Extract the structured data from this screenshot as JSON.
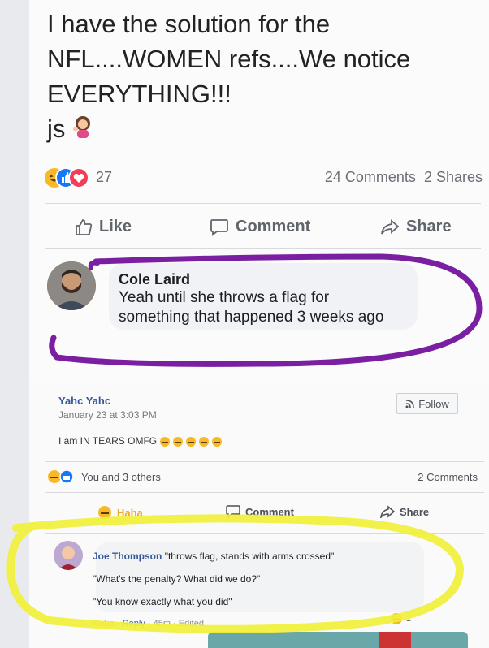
{
  "post": {
    "lines": [
      "I have the solution for the",
      "NFL....WOMEN refs....We notice",
      "EVERYTHING!!!",
      "js"
    ],
    "reaction_count": "27",
    "comments_count": "24 Comments",
    "shares_count": "2 Shares",
    "actions": {
      "like": "Like",
      "comment": "Comment",
      "share": "Share"
    }
  },
  "comment": {
    "author": "Cole Laird",
    "line1": "Yeah until she throws a flag for",
    "line2": "something that happened 3 weeks ago"
  },
  "embedded": {
    "author": "Yahc Yahc",
    "date": "January 23 at 3:03 PM",
    "text": "I am IN TEARS OMFG",
    "follow": "Follow",
    "reactions_text": "You and 3 others",
    "comments_count": "2 Comments",
    "actions": {
      "haha": "Haha",
      "comment": "Comment",
      "share": "Share"
    },
    "reply": {
      "author": "Joe Thompson",
      "line1": "\"throws flag, stands with arms crossed\"",
      "line2": "\"What's the penalty? What did we do?\"",
      "line3": "\"You know exactly what you did\"",
      "meta_haha": "Haha",
      "meta_reply": "Reply",
      "meta_time": "45m",
      "meta_edited": "Edited",
      "reaction_count": "1"
    }
  },
  "colors": {
    "highlight_purple": "#7b1fa2",
    "highlight_yellow": "#f0f03a",
    "link_blue": "#365899",
    "like_blue": "#1877f2",
    "love_red": "#f33e58",
    "haha_yellow": "#f7b928"
  }
}
